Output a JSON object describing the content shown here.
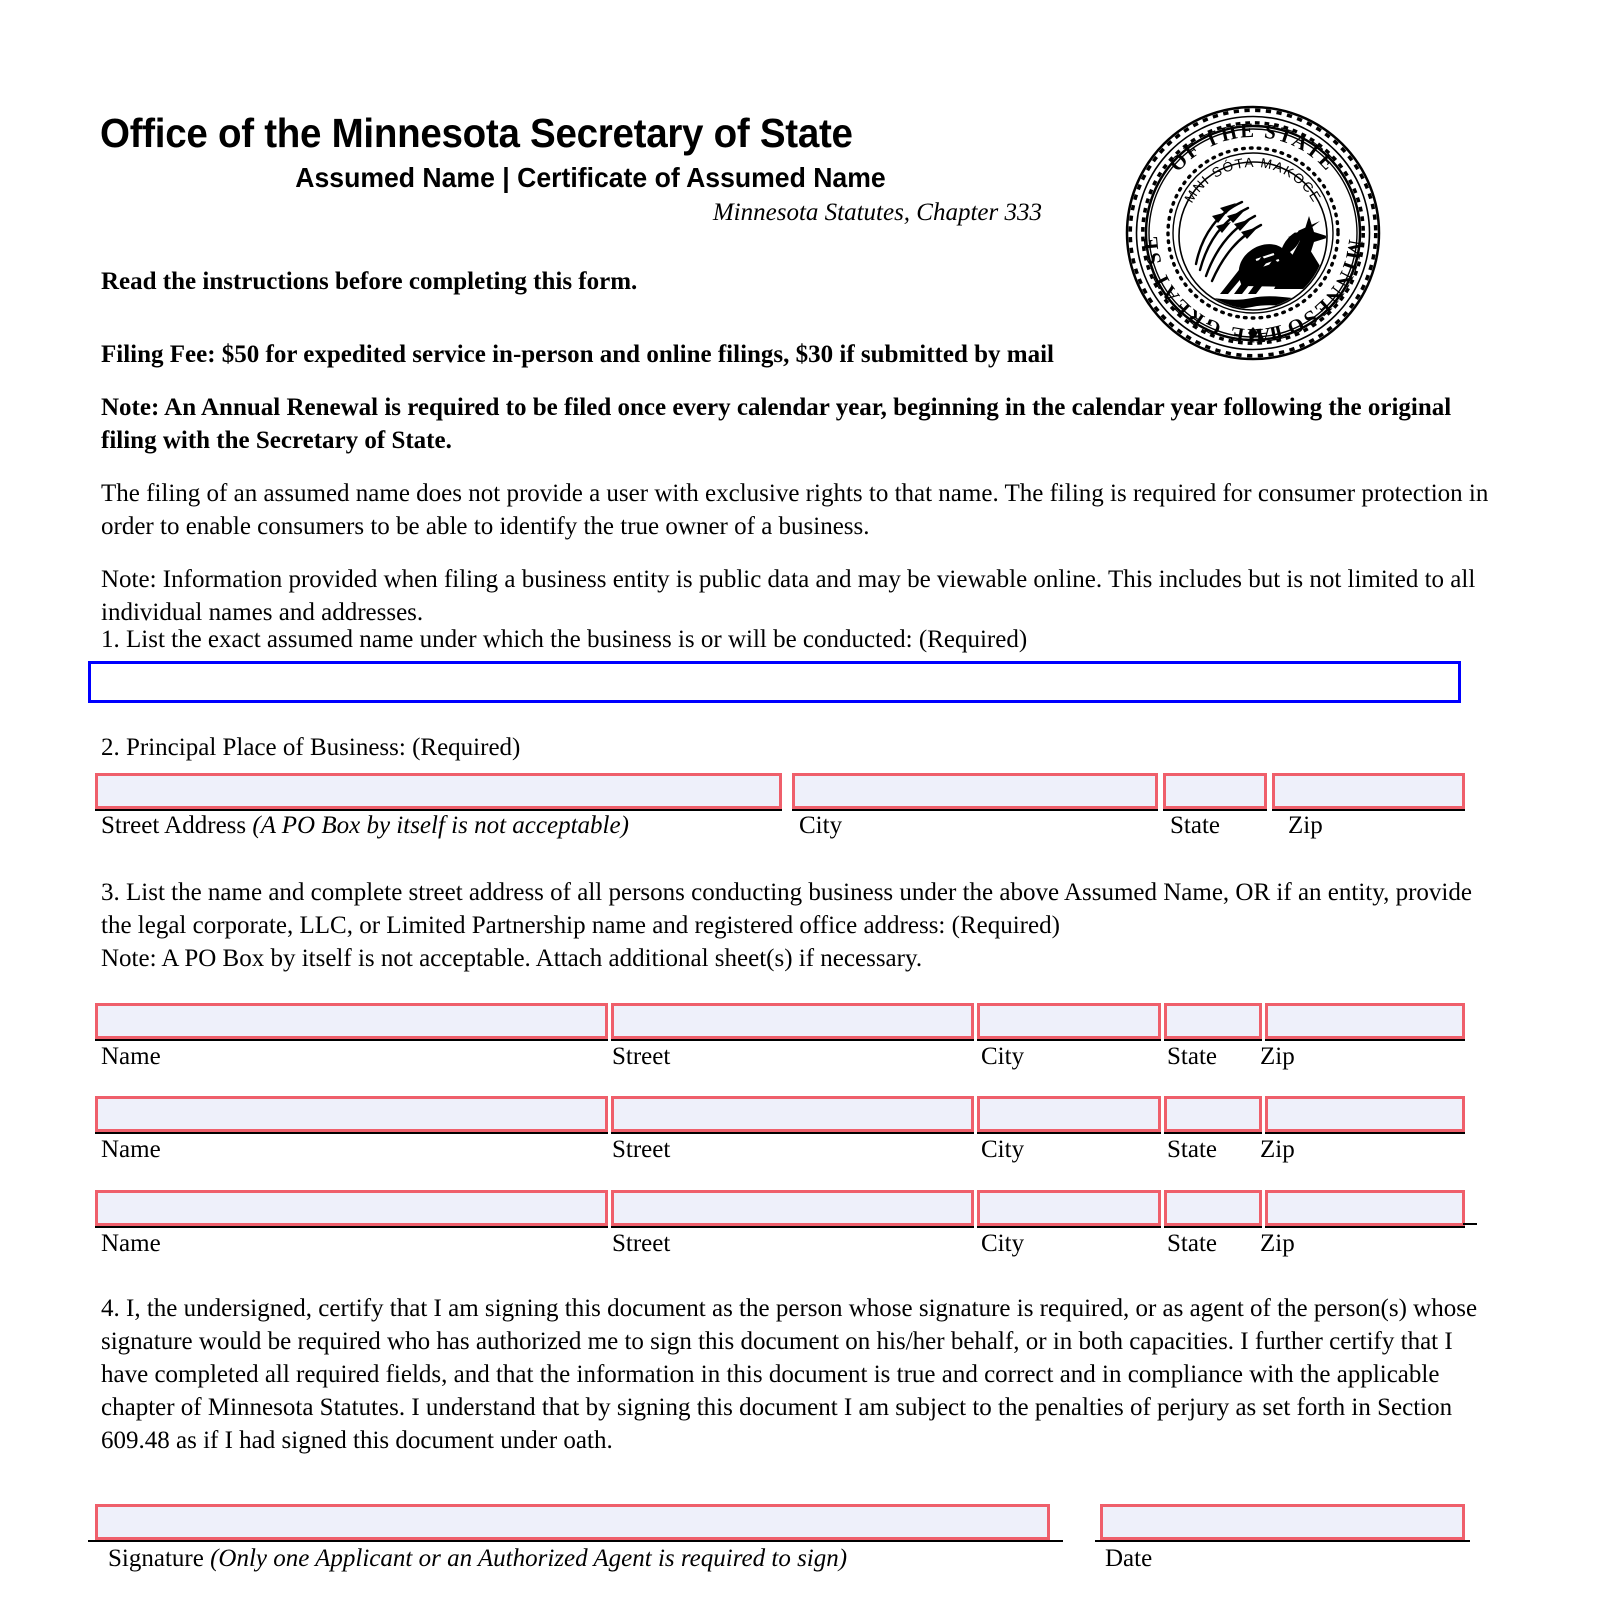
{
  "document": {
    "title_main": "Office of the Minnesota Secretary of State",
    "title_sub": "Assumed Name | Certificate of Assumed Name",
    "statute": "Minnesota Statutes, Chapter 333",
    "read_instructions": "Read the instructions before completing this form.",
    "filing_fee": "Filing Fee: $50 for expedited service in-person and online filings, $30 if submitted by mail",
    "note_renewal": "Note:  An Annual Renewal is required to be filed once every calendar year, beginning in the calendar year following the original filing with the Secretary of State.",
    "para_exclusive": "The filing of an assumed name does not provide a user with exclusive rights to that name. The filing is required for consumer protection in order to enable consumers to be able to identify the true owner of a business.",
    "para_public": "Note: Information provided when filing a business entity is public data and may be viewable online. This includes but is not limited to all individual names and addresses."
  },
  "seal": {
    "outer_text": "THE GREAT SEAL OF THE STATE OF MINNESOTA",
    "inner_text": "MNI SÓTA MAKOCE",
    "icon": "minnesota-state-seal"
  },
  "section1": {
    "label": "1. List the exact assumed name under which the business is or will be conducted: (Required)",
    "field_value": "",
    "border_color": "#0000ff",
    "fill_color": "#ffffff"
  },
  "section2": {
    "label": "2. Principal Place of Business: (Required)",
    "columns": [
      {
        "label_prefix": "Street Address ",
        "label_italic": "(A PO Box by itself is not acceptable)",
        "value": ""
      },
      {
        "label_prefix": "City",
        "label_italic": "",
        "value": ""
      },
      {
        "label_prefix": "State",
        "label_italic": "",
        "value": ""
      },
      {
        "label_prefix": "Zip",
        "label_italic": "",
        "value": ""
      }
    ]
  },
  "section3": {
    "label_line1": "3. List the name and complete street address of all persons conducting business under the above Assumed Name, OR if",
    "label_line2": "an entity, provide the legal corporate, LLC, or Limited Partnership name and registered office address: (Required)",
    "label_line3": "Note: A PO Box by itself is not acceptable.  Attach additional sheet(s) if necessary.",
    "column_headers": [
      "Name",
      "Street",
      "City",
      "State",
      "Zip"
    ],
    "rows": [
      {
        "name": "",
        "street": "",
        "city": "",
        "state": "",
        "zip": ""
      },
      {
        "name": "",
        "street": "",
        "city": "",
        "state": "",
        "zip": ""
      },
      {
        "name": "",
        "street": "",
        "city": "",
        "state": "",
        "zip": ""
      }
    ]
  },
  "section4": {
    "label": "4. I, the undersigned, certify that I am signing this document as the person whose signature is required, or as agent of the person(s) whose signature would be required who has authorized me to sign this document on his/her behalf, or in both capacities.  I further certify that I have completed all required fields, and that the information in this document is true and correct and in compliance with the applicable chapter of Minnesota Statutes.  I understand that by signing this document I am subject to the penalties of perjury as set forth in Section 609.48 as if I had signed this document under oath.",
    "signature_label_prefix": "Signature ",
    "signature_label_italic": "(Only one Applicant or an Authorized Agent is required to sign)",
    "date_label": "Date",
    "signature_value": "",
    "date_value": ""
  },
  "colors": {
    "field_border_red": "#ef5f6b",
    "field_fill": "#eef0fa",
    "field_border_blue": "#0000ff",
    "underline": "#000000"
  }
}
